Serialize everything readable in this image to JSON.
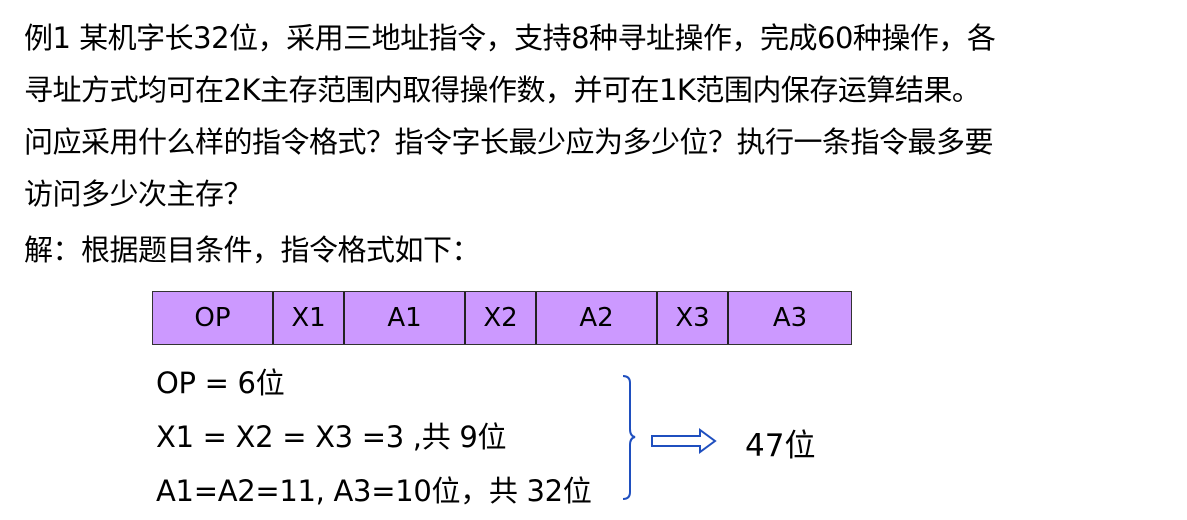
{
  "problem": {
    "lines": [
      "例1 某机字长32位，采用三地址指令，支持8种寻址操作，完成60种操作，各",
      "寻址方式均可在2K主存范围内取得操作数，并可在1K范围内保存运算结果。",
      "问应采用什么样的指令格式？指令字长最少应为多少位？执行一条指令最多要",
      "访问多少次主存？"
    ]
  },
  "solution": {
    "intro": "解：根据题目条件，指令格式如下："
  },
  "format_fields": [
    "OP",
    "X1",
    "A1",
    "X2",
    "A2",
    "X3",
    "A3"
  ],
  "colors": {
    "field_fill": "#cc99ff",
    "brace_arrow": "#1f4fbf"
  },
  "equations": [
    "OP = 6位",
    "X1 = X2 = X3  =3 ,共 9位",
    "A1=A2=11, A3=10位，共 32位"
  ],
  "result": "47位"
}
